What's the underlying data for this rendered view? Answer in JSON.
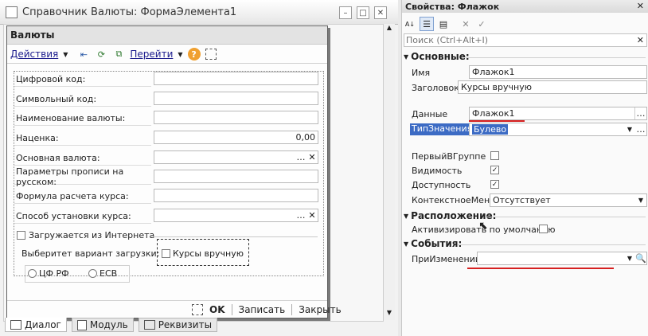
{
  "left_window": {
    "title": "Справочник Валюты: ФормаЭлемента1",
    "form_title": "Валюты",
    "toolbar": {
      "actions": "Действия",
      "goto": "Перейти"
    },
    "fields": [
      {
        "label": "Цифровой код:",
        "value": ""
      },
      {
        "label": "Символьный код:",
        "value": ""
      },
      {
        "label": "Наименование валюты:",
        "value": ""
      },
      {
        "label": "Наценка:",
        "value": "0,00"
      },
      {
        "label": "Основная валюта:",
        "value": ""
      },
      {
        "label": "Параметры прописи на русском:",
        "value": ""
      },
      {
        "label": "Формула расчета курса:",
        "value": ""
      },
      {
        "label": "Способ установки курса:",
        "value": ""
      }
    ],
    "checkbox_internet": "Загружается из Интернета",
    "choose_label": "Выберитет вариант загрузки:",
    "checkbox_manual": "Курсы вручную",
    "radio_cbr": "ЦФ РФ",
    "radio_ecb": "ЕСВ",
    "buttons": {
      "ok": "OK",
      "save": "Записать",
      "close": "Закрыть"
    },
    "bottom_tabs": [
      "Диалог",
      "Модуль",
      "Реквизиты"
    ]
  },
  "right_panel": {
    "title": "Свойства: Флажок",
    "search_placeholder": "Поиск (Ctrl+Alt+I)",
    "sections": {
      "main": "Основные:",
      "layout": "Расположение:",
      "events": "События:"
    },
    "props": {
      "name_label": "Имя",
      "name_value": "Флажок1",
      "caption_label": "Заголовок",
      "caption_value": "Курсы вручную",
      "data_label": "Данные",
      "data_value": "Флажок1",
      "type_label": "ТипЗначения",
      "type_value": "Булево",
      "first_in_group": "ПервыйВГруппе",
      "visibility": "Видимость",
      "enabled": "Доступность",
      "context_menu_label": "КонтекстноеМеню",
      "context_menu_value": "Отсутствует",
      "activate_default": "Активизировать по умолчанию",
      "on_change_label": "ПриИзменении",
      "on_change_value": ""
    }
  }
}
